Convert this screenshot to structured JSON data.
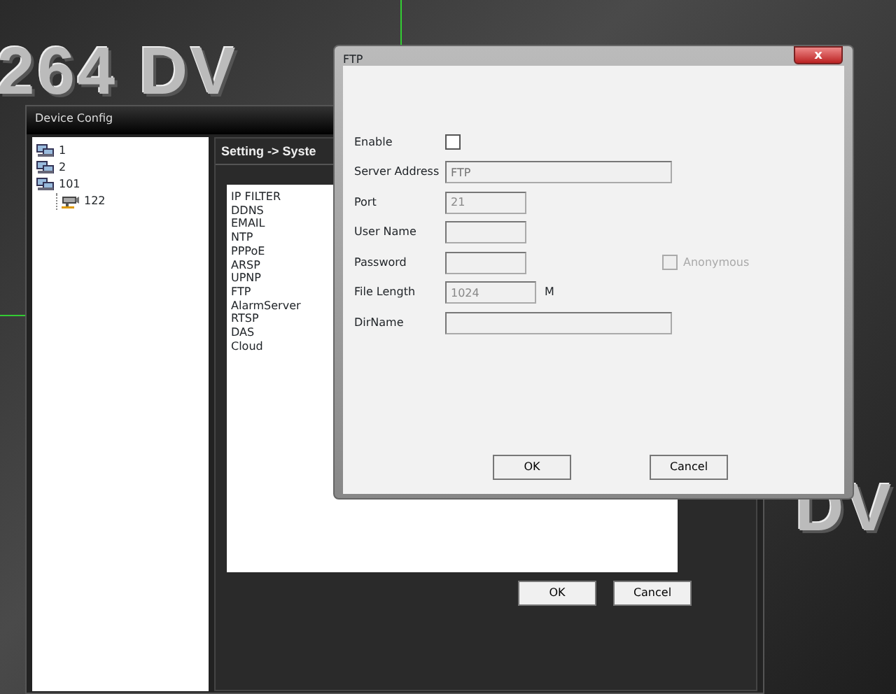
{
  "wallpaper": {
    "logos": [
      "264 DV",
      "DV"
    ]
  },
  "device_config": {
    "title": "Device Config",
    "tree": [
      {
        "label": "1",
        "kind": "group"
      },
      {
        "label": "2",
        "kind": "group"
      },
      {
        "label": "101",
        "kind": "group",
        "children": [
          {
            "label": "122",
            "kind": "device"
          }
        ]
      }
    ],
    "breadcrumb": "Setting -> Syste",
    "menu_items": [
      "IP FILTER",
      "DDNS",
      "EMAIL",
      "NTP",
      "PPPoE",
      "ARSP",
      "UPNP",
      "FTP",
      "AlarmServer",
      "RTSP",
      "DAS",
      "Cloud"
    ],
    "buttons": [
      "OK",
      "Cancel"
    ]
  },
  "ftp_dialog": {
    "title": "FTP",
    "close": "x",
    "fields": [
      {
        "kind": "checkbox",
        "label": "Enable",
        "checked": false
      },
      {
        "kind": "text",
        "label": "Server Address",
        "placeholder": "FTP"
      },
      {
        "kind": "text",
        "label": "Port",
        "value": "21"
      },
      {
        "kind": "text",
        "label": "User Name"
      },
      {
        "kind": "text",
        "label": "Password",
        "option": {
          "label": "Anonymous",
          "checked": false,
          "disabled": true
        }
      },
      {
        "kind": "text",
        "label": "File Length",
        "value": "1024",
        "unit": "M"
      },
      {
        "kind": "text",
        "label": "DirName"
      }
    ],
    "buttons": [
      "OK",
      "Cancel"
    ]
  }
}
